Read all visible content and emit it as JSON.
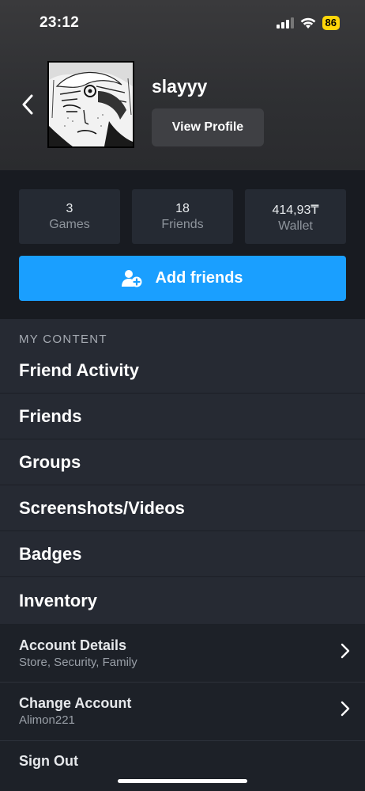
{
  "status_bar": {
    "time": "23:12",
    "battery": "86"
  },
  "profile": {
    "username": "slayyy",
    "view_profile_label": "View Profile"
  },
  "stats": [
    {
      "value": "3",
      "label": "Games"
    },
    {
      "value": "18",
      "label": "Friends"
    },
    {
      "value": "414,93₸",
      "label": "Wallet"
    }
  ],
  "add_friends": {
    "label": "Add friends"
  },
  "my_content": {
    "title": "MY CONTENT",
    "items": [
      {
        "label": "Friend Activity"
      },
      {
        "label": "Friends"
      },
      {
        "label": "Groups"
      },
      {
        "label": "Screenshots/Videos"
      },
      {
        "label": "Badges"
      },
      {
        "label": "Inventory"
      }
    ]
  },
  "account": {
    "details": {
      "title": "Account Details",
      "subtitle": "Store, Security, Family"
    },
    "change": {
      "title": "Change Account",
      "subtitle": "Alimon221"
    },
    "sign_out": "Sign Out"
  },
  "colors": {
    "accent": "#1a9fff",
    "battery": "#ffd60a"
  },
  "icons": [
    "back-chevron-icon",
    "cellular-signal-icon",
    "wifi-icon",
    "battery-icon",
    "add-friend-icon",
    "chevron-right-icon"
  ]
}
